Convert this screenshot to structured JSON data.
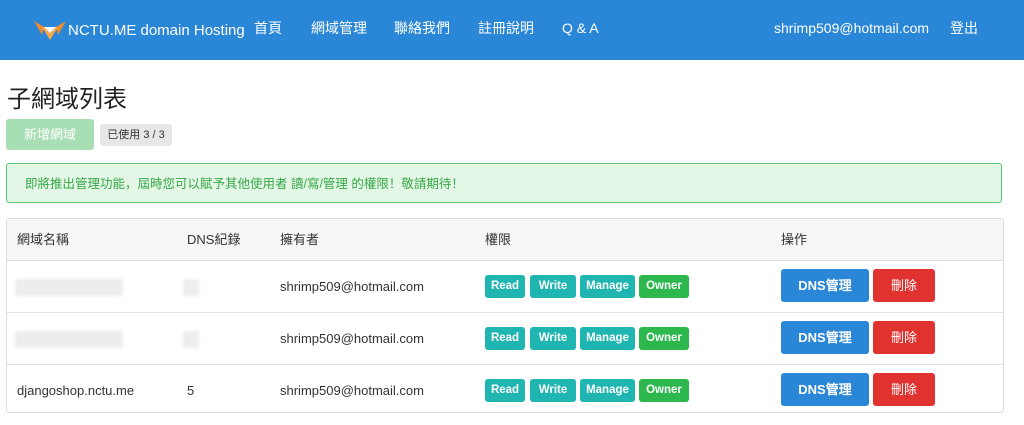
{
  "navbar": {
    "brand": "NCTU.ME domain Hosting",
    "links": [
      "首頁",
      "網域管理",
      "聯絡我們",
      "註冊說明",
      "Q & A"
    ],
    "user_email": "shrimp509@hotmail.com",
    "logout_label": "登出",
    "logo_icon": "fox-logo-icon"
  },
  "page": {
    "title": "子網域列表",
    "add_button": "新增網域",
    "usage_badge": "已使用 3 / 3",
    "notice": "即將推出管理功能，屆時您可以賦予其他使用者 讀/寫/管理 的權限！敬請期待！"
  },
  "table": {
    "headers": [
      "網域名稱",
      "DNS紀錄",
      "擁有者",
      "權限",
      "操作"
    ],
    "rows": [
      {
        "domain": "",
        "dns_records": "",
        "owner": "shrimp509@hotmail.com",
        "redacted": true
      },
      {
        "domain": "",
        "dns_records": "",
        "owner": "shrimp509@hotmail.com",
        "redacted": true
      },
      {
        "domain": "djangoshop.nctu.me",
        "dns_records": "5",
        "owner": "shrimp509@hotmail.com",
        "redacted": false
      }
    ],
    "permissions": [
      "Read",
      "Write",
      "Manage",
      "Owner"
    ],
    "dns_button": "DNS管理",
    "delete_button": "刪除"
  },
  "colors": {
    "navbar": "#2a86d6",
    "add_button": "#a7deb4",
    "notice_bg": "#e4f7e7",
    "notice_text": "#36a847",
    "perm_teal": "#1fb5b1",
    "perm_owner": "#2cb84c",
    "dns_button": "#2a86d6",
    "delete_button": "#e0322f"
  }
}
